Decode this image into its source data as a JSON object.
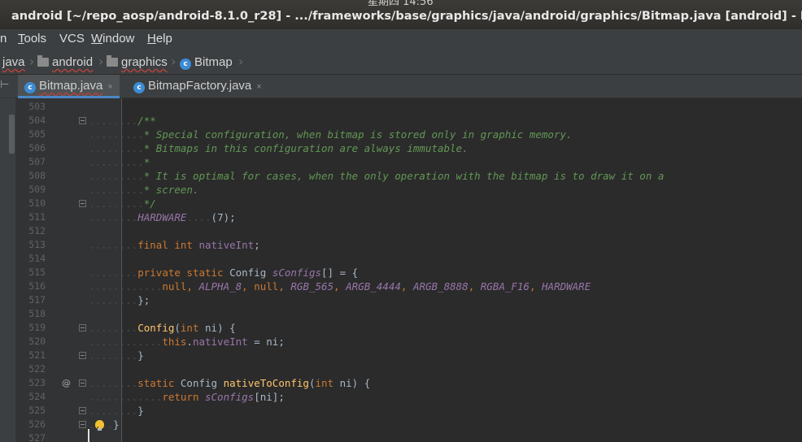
{
  "window": {
    "clock": "星期四 14:56",
    "title": "android [~/repo_aosp/android-8.1.0_r28] - .../frameworks/base/graphics/java/android/graphics/Bitmap.java [android] - IntelliJ IDEA"
  },
  "menu": {
    "items": [
      {
        "label": "n",
        "mnemonic": ""
      },
      {
        "label": "ools",
        "mnemonic": "T"
      },
      {
        "label": "VCS",
        "mnemonic": ""
      },
      {
        "label": "indow",
        "mnemonic": "W"
      },
      {
        "label": "elp",
        "mnemonic": "H"
      }
    ]
  },
  "breadcrumb": {
    "items": [
      "java",
      "android",
      "graphics",
      "Bitmap"
    ],
    "class_badge": "c"
  },
  "tabs": [
    {
      "label": "Bitmap.java",
      "badge": "c",
      "close": "×",
      "active": true
    },
    {
      "label": "BitmapFactory.java",
      "badge": "c",
      "close": "×",
      "active": false
    }
  ],
  "editor": {
    "line_numbers": [
      "503",
      "504",
      "505",
      "506",
      "507",
      "508",
      "509",
      "510",
      "511",
      "512",
      "513",
      "514",
      "515",
      "516",
      "517",
      "518",
      "519",
      "520",
      "521",
      "522",
      "523",
      "524",
      "525",
      "526",
      "527"
    ],
    "override_marker": "@",
    "lines": {
      "l504": "/**",
      "l505": "* Special configuration, when bitmap is stored only in graphic memory.",
      "l506": "* Bitmaps in this configuration are always immutable.",
      "l507": "*",
      "l508": "* It is optimal for cases, when the only operation with the bitmap is to draw it on a",
      "l509": "* screen.",
      "l510": "*/",
      "l511_const": "HARDWARE",
      "l511_rest": "(7);",
      "l513_kw": "final int",
      "l513_field": "nativeInt",
      "l513_end": ";",
      "l515_kw": "private static",
      "l515_type": "Config",
      "l515_field": "sConfigs",
      "l515_end": "[] = {",
      "l516_null1": "null",
      "l516_c1": "ALPHA_8",
      "l516_null2": "null",
      "l516_c2": "RGB_565",
      "l516_c3": "ARGB_4444",
      "l516_c4": "ARGB_8888",
      "l516_c5": "RGBA_F16",
      "l516_c6": "HARDWARE",
      "l517": "};",
      "l519_fn": "Config",
      "l519_kw": "int",
      "l519_rest": "ni) {",
      "l520_kw": "this",
      "l520_field": "nativeInt",
      "l520_rest": "= ni;",
      "l521": "}",
      "l523_kw": "static",
      "l523_type": "Config",
      "l523_fn": "nativeToConfig",
      "l523_kw2": "int",
      "l523_rest": "ni) {",
      "l524_kw": "return",
      "l524_field": "sConfigs",
      "l524_rest": "[ni];",
      "l525": "}",
      "l526": "}"
    }
  },
  "colors": {
    "background": "#2b2b2b",
    "keyword": "#cc7832",
    "doc_comment": "#629755",
    "constant": "#9876aa",
    "method": "#ffc66d",
    "tab_accent": "#4a88c7"
  }
}
